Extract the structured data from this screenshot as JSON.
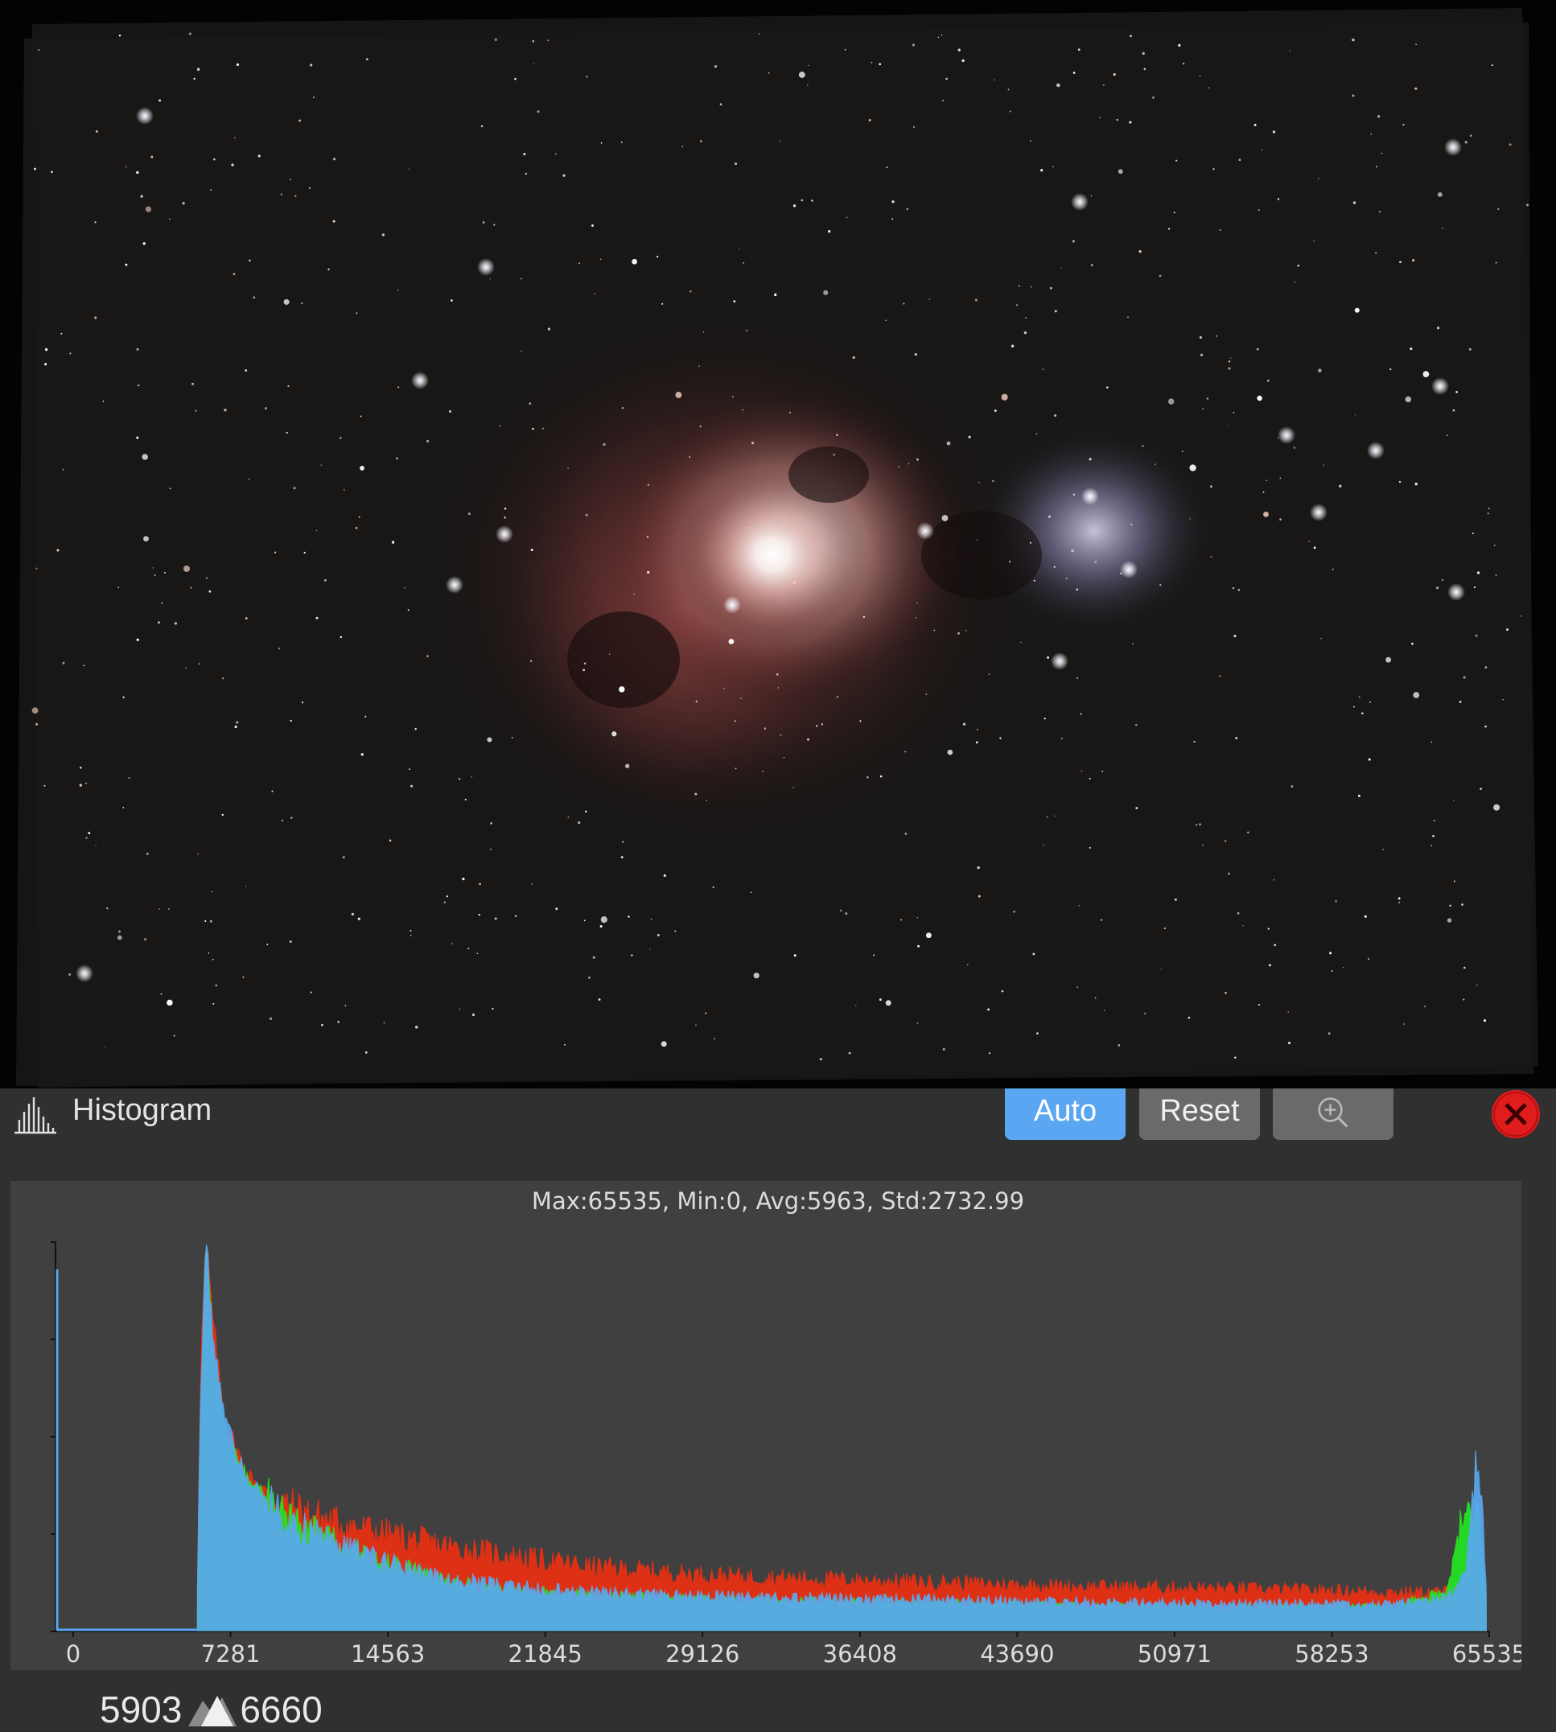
{
  "histogram": {
    "title": "Histogram",
    "buttons": {
      "auto": "Auto",
      "reset": "Reset"
    },
    "icons": {
      "panel": "histogram-icon",
      "zoom": "zoom-in-icon",
      "close": "close-icon",
      "range": "mountain-icon"
    },
    "colors": {
      "accent": "#5aa6f2",
      "close": "#e01c1c",
      "red_channel": "#e63012",
      "green_channel": "#22e522",
      "blue_channel": "#5aa9f0"
    },
    "stats": "Max:65535, Min:0, Avg:5963, Std:2732.99",
    "range": {
      "low": "5903",
      "high": "6660"
    }
  },
  "chart_data": {
    "type": "area",
    "x_tick_labels": [
      "0",
      "7281",
      "14563",
      "21845",
      "29126",
      "36408",
      "43690",
      "50971",
      "58253",
      "65535"
    ],
    "xlim": [
      0,
      65535
    ],
    "ylim": [
      0,
      1
    ],
    "series": [
      {
        "color": "#e63012",
        "x": [
          5750,
          5900,
          6150,
          6500,
          7000,
          8000,
          9500,
          11000,
          12500,
          14500,
          17000,
          20000,
          24000,
          29000,
          34000,
          40000,
          46000,
          52000,
          57000,
          61000,
          63500,
          64000,
          64500,
          65000,
          65200,
          65400
        ],
        "values": [
          0.1,
          0.7,
          1.0,
          0.78,
          0.55,
          0.41,
          0.33,
          0.3,
          0.275,
          0.25,
          0.22,
          0.195,
          0.165,
          0.145,
          0.135,
          0.125,
          0.115,
          0.11,
          0.105,
          0.1,
          0.1,
          0.12,
          0.14,
          0.12,
          0.11,
          0.1
        ]
      },
      {
        "color": "#22e522",
        "x": [
          5750,
          5900,
          6150,
          6500,
          7000,
          8000,
          9500,
          11000,
          12500,
          14500,
          17000,
          20000,
          24000,
          29000,
          34000,
          40000,
          46000,
          52000,
          57000,
          61000,
          63500,
          64000,
          64500,
          65000,
          65200,
          65400
        ],
        "values": [
          0.05,
          0.55,
          0.97,
          0.72,
          0.53,
          0.4,
          0.31,
          0.26,
          0.22,
          0.18,
          0.13,
          0.105,
          0.09,
          0.08,
          0.075,
          0.07,
          0.065,
          0.06,
          0.06,
          0.06,
          0.1,
          0.2,
          0.37,
          0.3,
          0.18,
          0.08
        ]
      },
      {
        "color": "#5aa9f0",
        "x": [
          5750,
          5900,
          6150,
          6500,
          7000,
          8000,
          9500,
          11000,
          12500,
          14500,
          17000,
          20000,
          24000,
          29000,
          34000,
          40000,
          46000,
          52000,
          57000,
          61000,
          63500,
          64000,
          64500,
          65000,
          65200,
          65400
        ],
        "values": [
          0.1,
          0.65,
          1.0,
          0.74,
          0.54,
          0.4,
          0.3,
          0.255,
          0.215,
          0.175,
          0.135,
          0.115,
          0.1,
          0.09,
          0.085,
          0.08,
          0.075,
          0.072,
          0.07,
          0.068,
          0.085,
          0.1,
          0.16,
          0.5,
          0.35,
          0.1
        ]
      }
    ],
    "grid": false,
    "legend": "none"
  }
}
